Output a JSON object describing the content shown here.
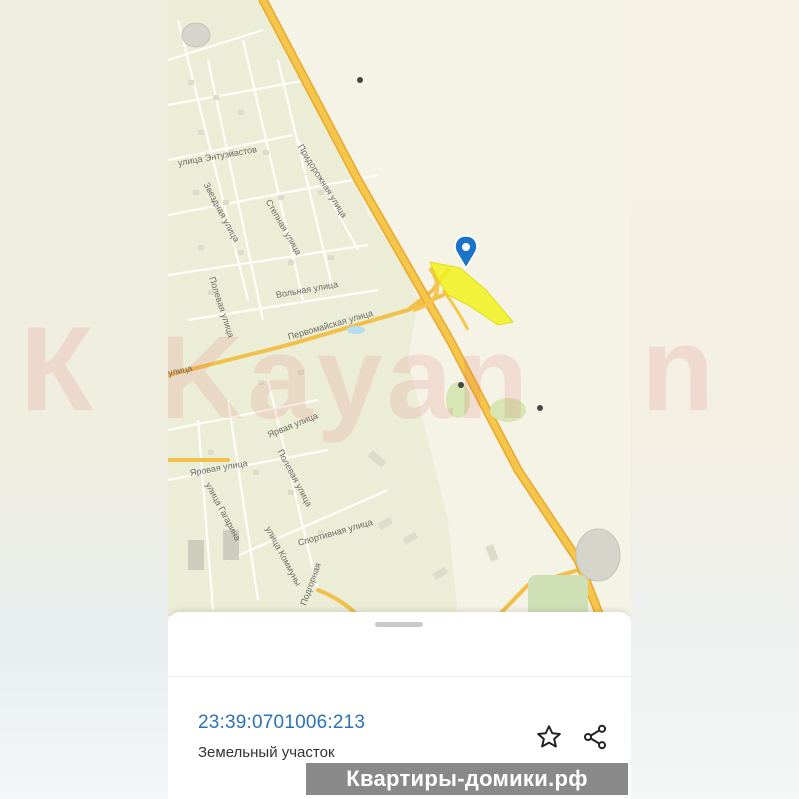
{
  "map": {
    "streets": [
      "улица Энтузиастов",
      "Придорожная улица",
      "Звездная улица",
      "Степная улица",
      "Полевая улица",
      "Вольная улица",
      "Первомайская улица",
      "Ярвая улица",
      "Полевая улица",
      "Яровая улица",
      "улица Гагарина",
      "Спортивная улица",
      "улица Коммуны",
      "Подгорная",
      "улица"
    ],
    "watermark": "Kayan",
    "pin_color": "#1a73c8",
    "highlight_color": "#f2f21e",
    "highway_color": "#f3bd3a"
  },
  "sheet": {
    "cadastral_number": "23:39:0701006:213",
    "object_type": "Земельный участок",
    "link_color": "#2a72b8"
  },
  "icons": {
    "favorite": "star-outline-icon",
    "share": "share-icon",
    "location": "map-pin-icon"
  },
  "brand": {
    "text": "Квартиры-домики.рф"
  }
}
